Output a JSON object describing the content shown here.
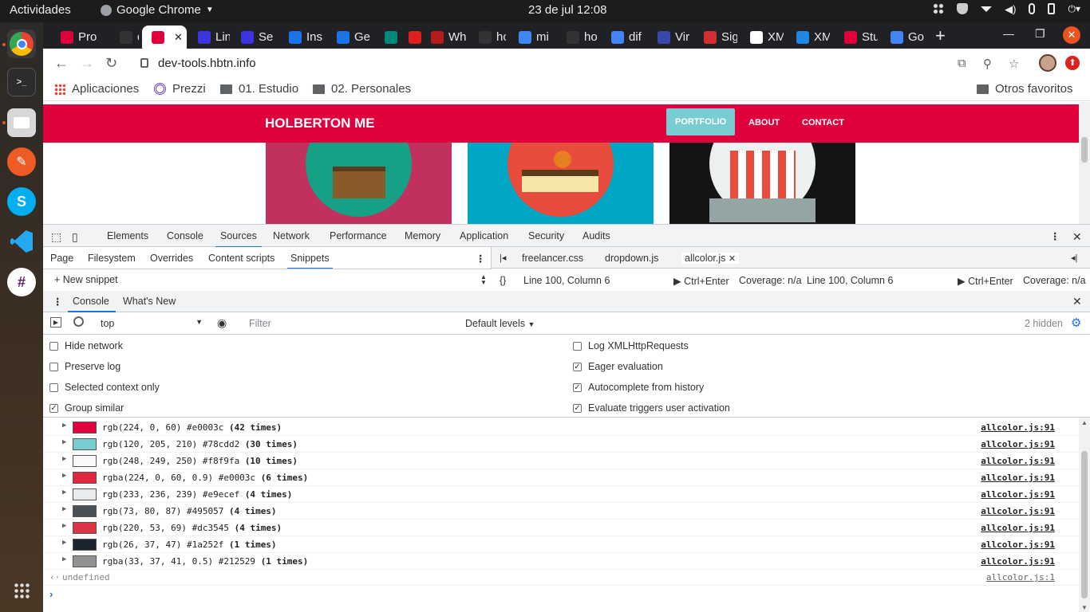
{
  "system_bar": {
    "activities": "Actividades",
    "app_name": "Google Chrome",
    "clock": "23 de jul  12:08"
  },
  "dock": {
    "items": [
      "chrome-icon",
      "terminal-icon",
      "files-icon",
      "postman-icon",
      "skype-icon",
      "vscode-icon",
      "slack-icon",
      "apps-grid-icon"
    ]
  },
  "browser": {
    "tabs": [
      {
        "label": "Pro",
        "favicon_color": "#e0003c"
      },
      {
        "label": "de",
        "favicon_color": "#333333"
      },
      {
        "label": "",
        "favicon_color": "#e0003c",
        "active": true
      },
      {
        "label": "Lin",
        "favicon_color": "#3c34e0"
      },
      {
        "label": "Se",
        "favicon_color": "#3c34e0"
      },
      {
        "label": "Ins",
        "favicon_color": "#1a73e8"
      },
      {
        "label": "Ge",
        "favicon_color": "#1a73e8"
      },
      {
        "label": "",
        "favicon_color": "#00897b"
      },
      {
        "label": "",
        "favicon_color": "#e0201c"
      },
      {
        "label": "Wh",
        "favicon_color": "#b71c1c"
      },
      {
        "label": "ho",
        "favicon_color": "#333333"
      },
      {
        "label": "mi",
        "favicon_color": "#4285f4"
      },
      {
        "label": "ho",
        "favicon_color": "#333333"
      },
      {
        "label": "dif",
        "favicon_color": "#4285f4"
      },
      {
        "label": "Vir",
        "favicon_color": "#3949ab"
      },
      {
        "label": "Sig",
        "favicon_color": "#d32f2f"
      },
      {
        "label": "XM",
        "favicon_color": "#ffffff"
      },
      {
        "label": "XM",
        "favicon_color": "#1e88e5"
      },
      {
        "label": "Stu",
        "favicon_color": "#e0003c"
      },
      {
        "label": "Go",
        "favicon_color": "#4285f4"
      }
    ],
    "url": "dev-tools.hbtn.info",
    "bookmarks": {
      "apps": "Aplicaciones",
      "prezzi": "Prezzi",
      "folder1": "01. Estudio",
      "folder2": "02. Personales",
      "others": "Otros favoritos"
    }
  },
  "page": {
    "brand": "HOLBERTON ME",
    "nav": [
      "PORTFOLIO",
      "ABOUT",
      "CONTACT"
    ],
    "cards": [
      {
        "bg": "#c2305e",
        "circle": "#16a085"
      },
      {
        "bg": "#00a8c6",
        "circle": "#e74c3c"
      },
      {
        "bg": "#141414",
        "circle": "#ecf0f1"
      }
    ]
  },
  "devtools": {
    "main_tabs": [
      "Elements",
      "Console",
      "Sources",
      "Network",
      "Performance",
      "Memory",
      "Application",
      "Security",
      "Audits"
    ],
    "active_main_tab": "Sources",
    "source_nav_tabs": [
      "Page",
      "Filesystem",
      "Overrides",
      "Content scripts",
      "Snippets"
    ],
    "active_source_tab": "Snippets",
    "new_snippet": "New snippet",
    "editor_tabs": [
      "freelancer.css",
      "dropdown.js",
      "allcolor.js"
    ],
    "status_left": {
      "position": "Line 100, Column 6",
      "run": "Ctrl+Enter",
      "coverage": "Coverage: n/a"
    },
    "status_right": {
      "position": "Line 100, Column 6",
      "run": "Ctrl+Enter",
      "coverage": "Coverage: n/a"
    },
    "drawer_tabs": [
      "Console",
      "What's New"
    ],
    "context": "top",
    "filter_placeholder": "Filter",
    "levels": "Default levels",
    "hidden": "2 hidden",
    "settings_left": [
      {
        "label": "Hide network",
        "checked": false
      },
      {
        "label": "Preserve log",
        "checked": false
      },
      {
        "label": "Selected context only",
        "checked": false
      },
      {
        "label": "Group similar",
        "checked": true
      }
    ],
    "settings_right": [
      {
        "label": "Log XMLHttpRequests",
        "checked": false
      },
      {
        "label": "Eager evaluation",
        "checked": true
      },
      {
        "label": "Autocomplete from history",
        "checked": true
      },
      {
        "label": "Evaluate triggers user activation",
        "checked": true
      }
    ],
    "logs": [
      {
        "color": "#e0003c",
        "text": "rgb(224, 0, 60) #e0003c",
        "count": "(42 times)",
        "source": "allcolor.js:91"
      },
      {
        "color": "#78cdd2",
        "text": "rgb(120, 205, 210) #78cdd2",
        "count": "(30 times)",
        "source": "allcolor.js:91"
      },
      {
        "color": "#f8f9fa",
        "text": "rgb(248, 249, 250) #f8f9fa",
        "count": "(10 times)",
        "source": "allcolor.js:91"
      },
      {
        "color": "#e3263f",
        "text": "rgba(224, 0, 60, 0.9) #e0003c",
        "count": "(6 times)",
        "source": "allcolor.js:91"
      },
      {
        "color": "#e9ecef",
        "text": "rgb(233, 236, 239) #e9ecef",
        "count": "(4 times)",
        "source": "allcolor.js:91"
      },
      {
        "color": "#495057",
        "text": "rgb(73, 80, 87) #495057",
        "count": "(4 times)",
        "source": "allcolor.js:91"
      },
      {
        "color": "#dc3545",
        "text": "rgb(220, 53, 69) #dc3545",
        "count": "(4 times)",
        "source": "allcolor.js:91"
      },
      {
        "color": "#1a252f",
        "text": "rgb(26, 37, 47) #1a252f",
        "count": "(1 times)",
        "source": "allcolor.js:91"
      },
      {
        "color": "#909193",
        "text": "rgba(33, 37, 41, 0.5) #212529",
        "count": "(1 times)",
        "source": "allcolor.js:91"
      }
    ],
    "result": {
      "value": "undefined",
      "source": "allcolor.js:1"
    }
  }
}
